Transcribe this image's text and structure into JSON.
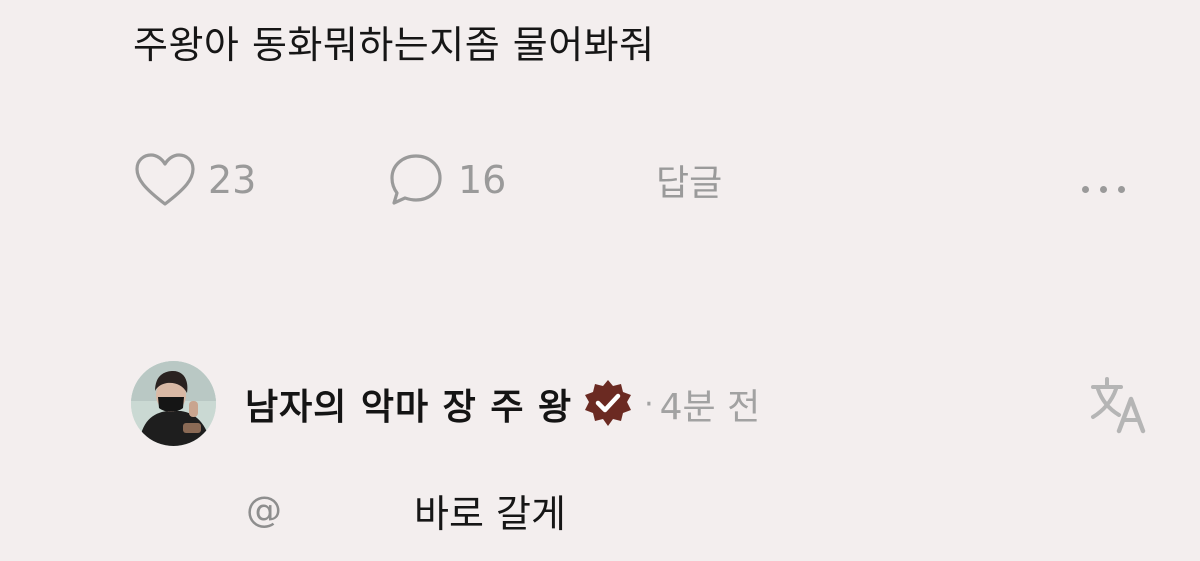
{
  "post": {
    "text": "주왕아 동화뭐하는지좀 물어봐줘"
  },
  "actions": {
    "like_count": "23",
    "comment_count": "16",
    "reply_label": "답글",
    "like_icon": "heart-icon",
    "comment_icon": "comment-bubble-icon",
    "more_icon": "more-dots-icon"
  },
  "reply": {
    "username": "남자의 악마 장 주 왕",
    "verified_icon": "verified-badge-icon",
    "separator": "·",
    "time": "4분 전",
    "translate_icon": "translate-icon",
    "mention": "@",
    "text": "바로 갈게"
  },
  "colors": {
    "background": "#f3eeee",
    "muted": "#9a9a9a",
    "badge": "#6b2a22"
  }
}
